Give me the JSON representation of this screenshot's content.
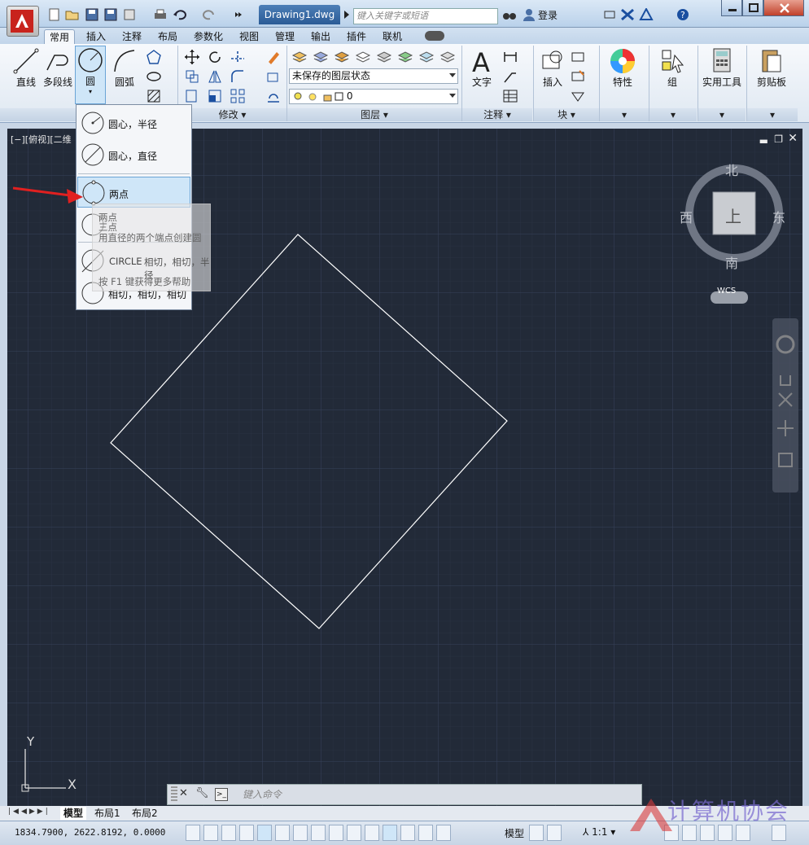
{
  "title_bar": {
    "document": "Drawing1.dwg",
    "search_placeholder": "键入关键字或短语",
    "login": "登录"
  },
  "ribbon_tabs": [
    "常用",
    "插入",
    "注释",
    "布局",
    "参数化",
    "视图",
    "管理",
    "输出",
    "插件",
    "联机"
  ],
  "active_tab": "常用",
  "ribbon": {
    "draw": {
      "line": "直线",
      "polyline": "多段线",
      "circle": "圆",
      "arc": "圆弧"
    },
    "modify": {
      "footer": "修改"
    },
    "layers": {
      "state_combo": "未保存的图层状态",
      "layer_combo": "0",
      "footer": "图层"
    },
    "annotation": {
      "text": "文字",
      "footer": "注释"
    },
    "block": {
      "insert": "插入",
      "footer": "块"
    },
    "properties": "特性",
    "group": "组",
    "utilities": "实用工具",
    "clipboard": "剪贴板"
  },
  "viewport": {
    "label": "[−][俯视][二维"
  },
  "circle_menu": {
    "items": [
      "圆心，半径",
      "圆心，直径",
      "两点",
      "三点",
      "相切，相切，半径",
      "相切，相切，相切"
    ],
    "selected": "两点"
  },
  "tooltip": {
    "title": "两点",
    "subtitle": "三点",
    "description": "用直径的两个端点创建圆",
    "command": "CIRCLE",
    "help": "按 F1 键获得更多帮助",
    "overlap_text": "相切，相切，半径"
  },
  "viewcube": {
    "north": "北",
    "south": "南",
    "east": "东",
    "west": "西",
    "face": "上",
    "wcs": "WCS"
  },
  "ucs": {
    "x": "X",
    "y": "Y"
  },
  "command_line": {
    "placeholder": "键入命令"
  },
  "layout_tabs": [
    "模型",
    "布局1",
    "布局2"
  ],
  "status": {
    "coordinates": "1834.7900,  2622.8192,  0.0000",
    "model": "模型",
    "scale": "1:1"
  },
  "watermark": "计算机协会",
  "colors": {
    "canvas": "#222a38",
    "grid": "#2f3847",
    "shape": "#ffffff",
    "highlight": "#cfe6f8",
    "arrow": "#e02020"
  }
}
